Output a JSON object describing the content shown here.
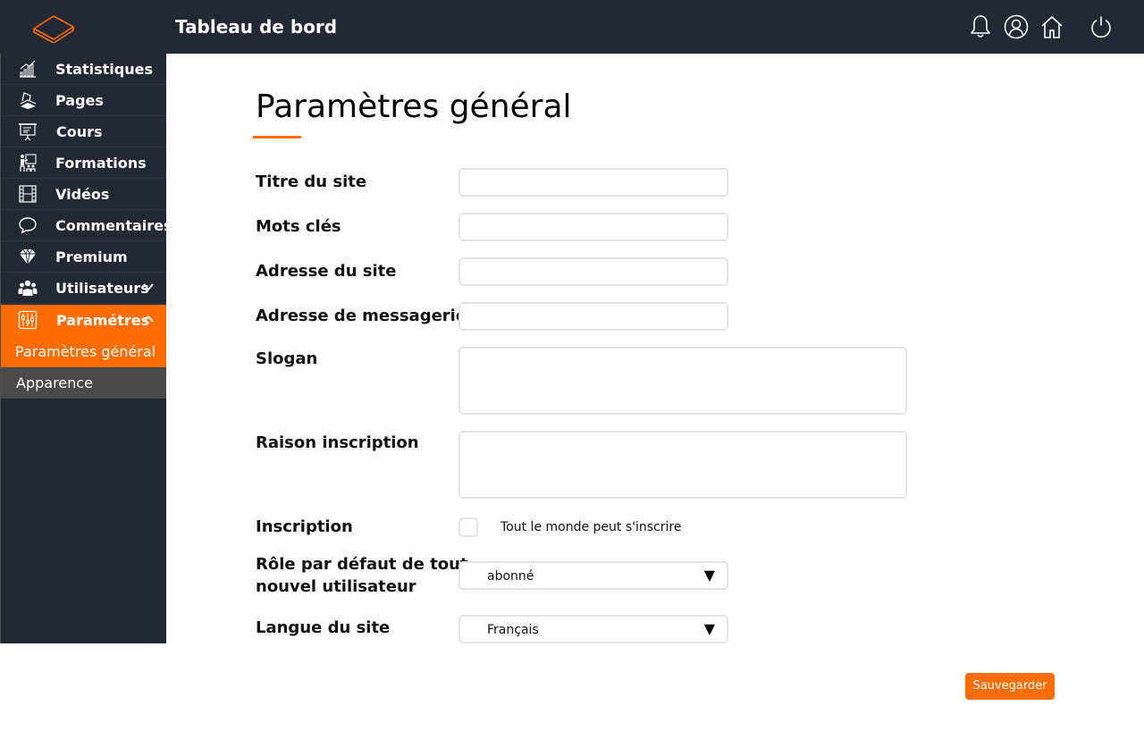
{
  "header": {
    "title": "Tableau de bord",
    "icons": [
      "bell-icon",
      "user-icon",
      "home-icon",
      "power-icon"
    ]
  },
  "colors": {
    "accent": "#ff6c00",
    "sidebar": "#222834",
    "submenu_grey": "#4a4a4a"
  },
  "sidebar": {
    "items": [
      {
        "label": "Statistiques",
        "icon": "chart-icon"
      },
      {
        "label": "Pages",
        "icon": "pages-icon"
      },
      {
        "label": "Cours",
        "icon": "presentation-icon"
      },
      {
        "label": "Formations",
        "icon": "training-icon"
      },
      {
        "label": "Vidéos",
        "icon": "film-icon"
      },
      {
        "label": "Commentaires",
        "icon": "comment-icon"
      },
      {
        "label": "Premium",
        "icon": "diamond-icon"
      },
      {
        "label": "Utilisateurs",
        "icon": "users-icon",
        "expandable": true
      },
      {
        "label": "Paramétres",
        "icon": "sliders-icon",
        "expanded": true,
        "active": true
      }
    ],
    "submenu": [
      {
        "label": "Paramètres général",
        "active": true
      },
      {
        "label": "Apparence",
        "active": false
      }
    ]
  },
  "main": {
    "title": "Paramètres général",
    "fields": {
      "site_title": {
        "label": "Titre du site",
        "value": ""
      },
      "keywords": {
        "label": "Mots clés",
        "value": ""
      },
      "site_address": {
        "label": "Adresse du site",
        "value": ""
      },
      "email_address": {
        "label": "Adresse de messagerie",
        "value": ""
      },
      "slogan": {
        "label": "Slogan",
        "value": ""
      },
      "signup_reason": {
        "label": "Raison inscription",
        "value": ""
      },
      "signup": {
        "label": "Inscription",
        "checkbox_label": "Tout le monde peut s'inscrire",
        "checked": false
      },
      "default_role": {
        "label_line1": "Rôle par défaut de tout",
        "label_line2": "nouvel utilisateur",
        "value": "abonné"
      },
      "site_language": {
        "label": "Langue du site",
        "value": "Français"
      }
    },
    "save_label": "Sauvegarder"
  }
}
